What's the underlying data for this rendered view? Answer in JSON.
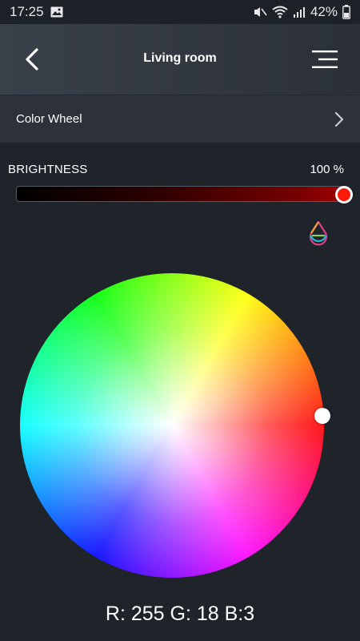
{
  "status_bar": {
    "time": "17:25",
    "battery": "42%",
    "icons": [
      "image-icon",
      "mute-vibrate-icon",
      "wifi-icon",
      "signal-icon",
      "battery-icon"
    ]
  },
  "header": {
    "title": "Living room",
    "back_icon": "back-arrow-icon",
    "menu_icon": "menu-icon"
  },
  "mode": {
    "label": "Color Wheel",
    "icon": "chevron-right-icon"
  },
  "brightness": {
    "label": "BRIGHTNESS",
    "value_text": "100 %",
    "value": 100,
    "thumb_color": "#ff1a08"
  },
  "picker": {
    "drop_icon": "color-drop-icon",
    "selected_color": "#ff1203"
  },
  "rgb": {
    "text": "R: 255 G: 18 B:3"
  },
  "colors": {
    "background": "#1f232a",
    "header": "#3a4049",
    "row": "#2d323a"
  }
}
